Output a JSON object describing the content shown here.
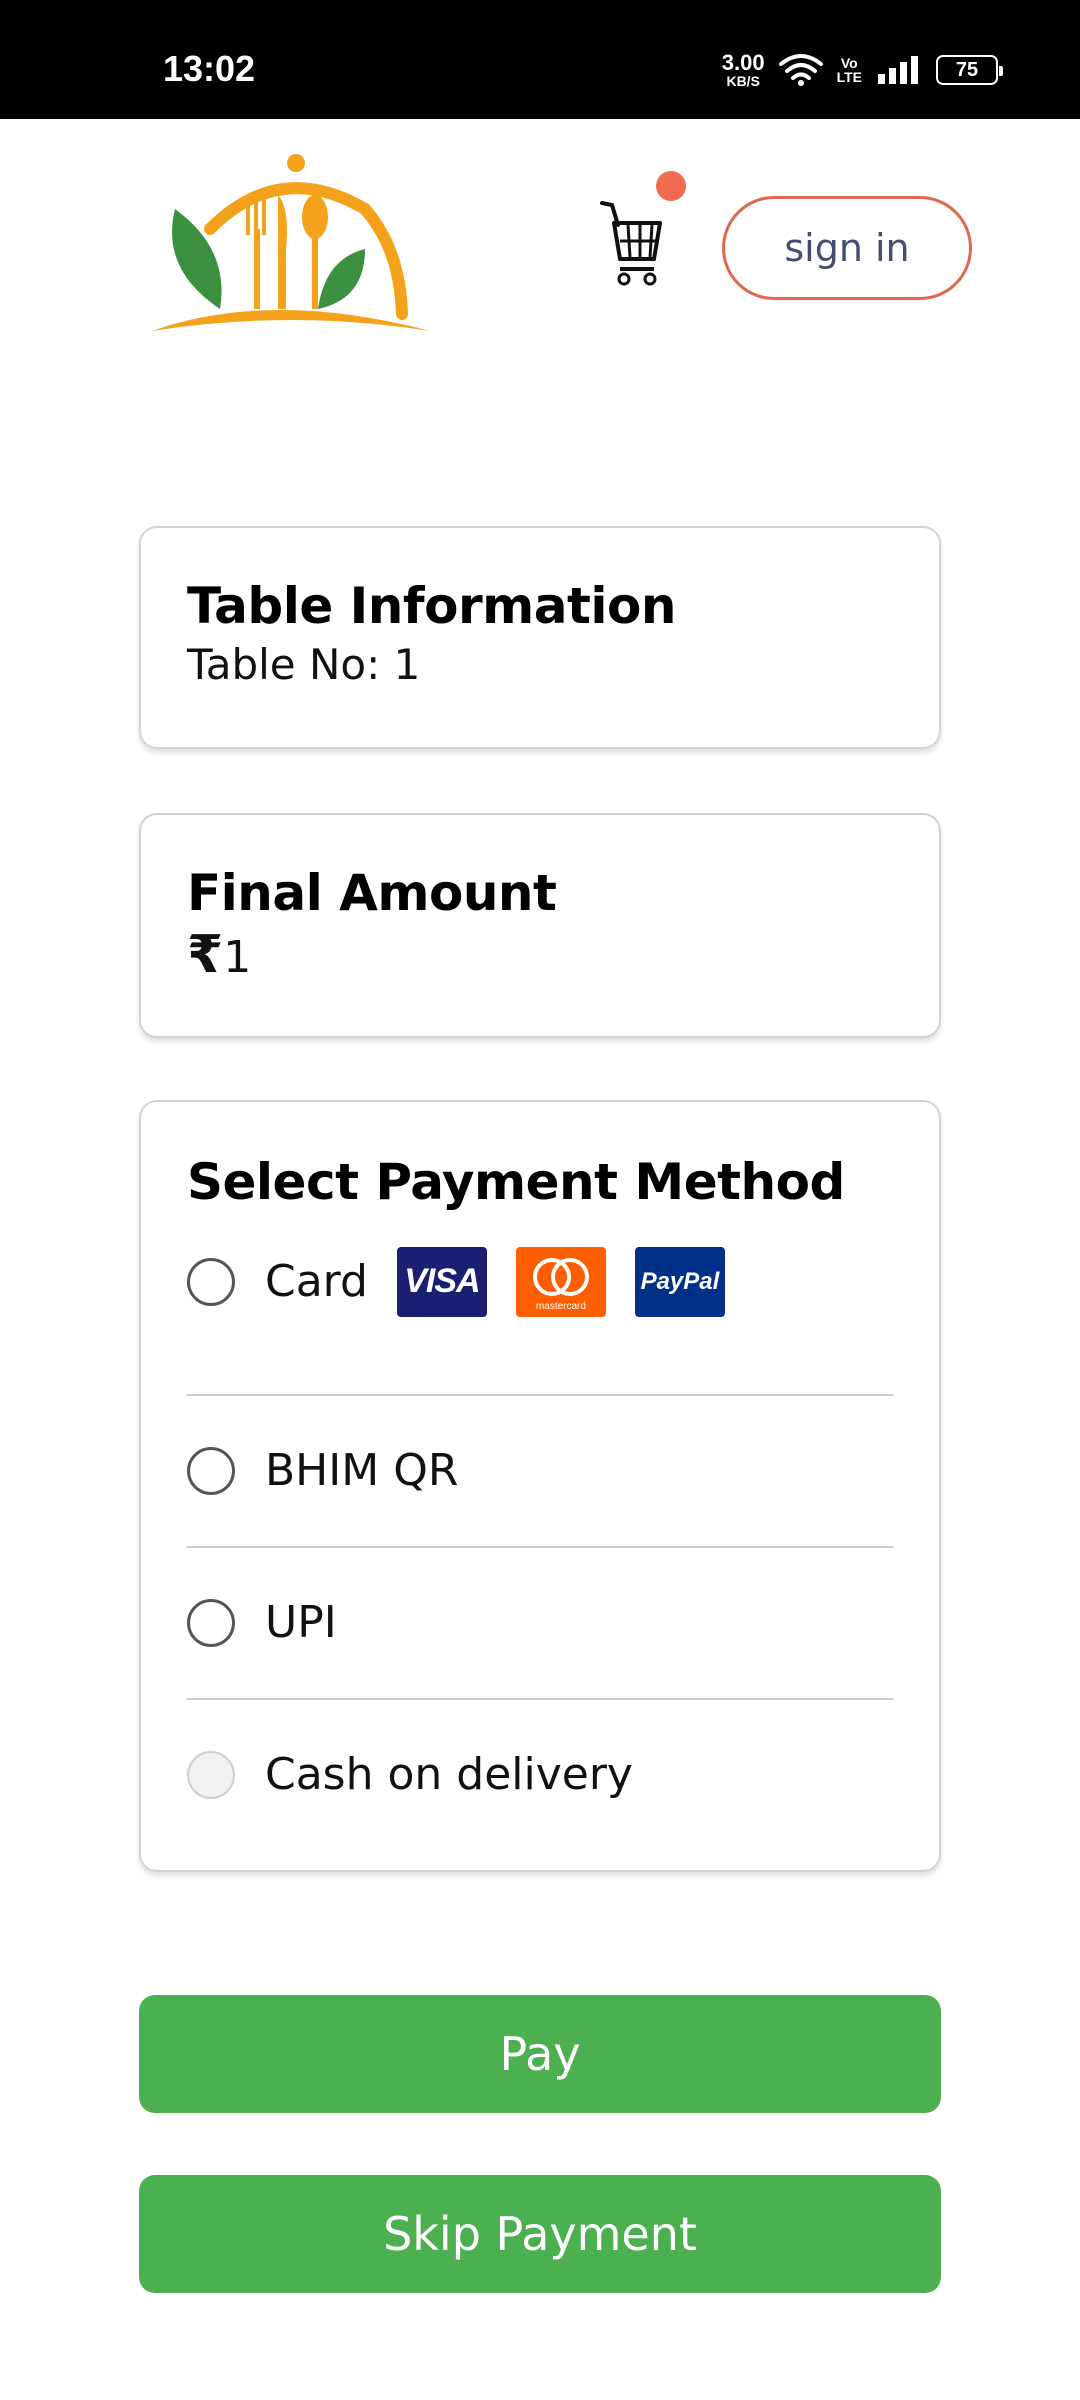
{
  "status_bar": {
    "time": "13:02",
    "net_speed_value": "3.00",
    "net_speed_unit": "KB/S",
    "volte_top": "Vo",
    "volte_bottom": "LTE",
    "battery": "75"
  },
  "header": {
    "signin_label": "sign in",
    "cart_badge_color": "#f26a4f",
    "logo_colors": {
      "leaf": "#3c8f3e",
      "cloche": "#f4a21c"
    }
  },
  "table_info": {
    "title": "Table Information",
    "table_no": "Table No: 1"
  },
  "final_amount": {
    "title": "Final Amount",
    "currency": "₹",
    "value": "1"
  },
  "payment": {
    "title": "Select Payment Method",
    "methods": [
      {
        "label": "Card",
        "enabled": true
      },
      {
        "label": "BHIM QR",
        "enabled": true
      },
      {
        "label": "UPI",
        "enabled": true
      },
      {
        "label": "Cash on delivery",
        "enabled": false
      }
    ],
    "brands": {
      "visa": "VISA",
      "mastercard": "mastercard",
      "paypal": "PayPal"
    }
  },
  "actions": {
    "pay_label": "Pay",
    "skip_label": "Skip Payment",
    "button_color": "#4caf50"
  }
}
